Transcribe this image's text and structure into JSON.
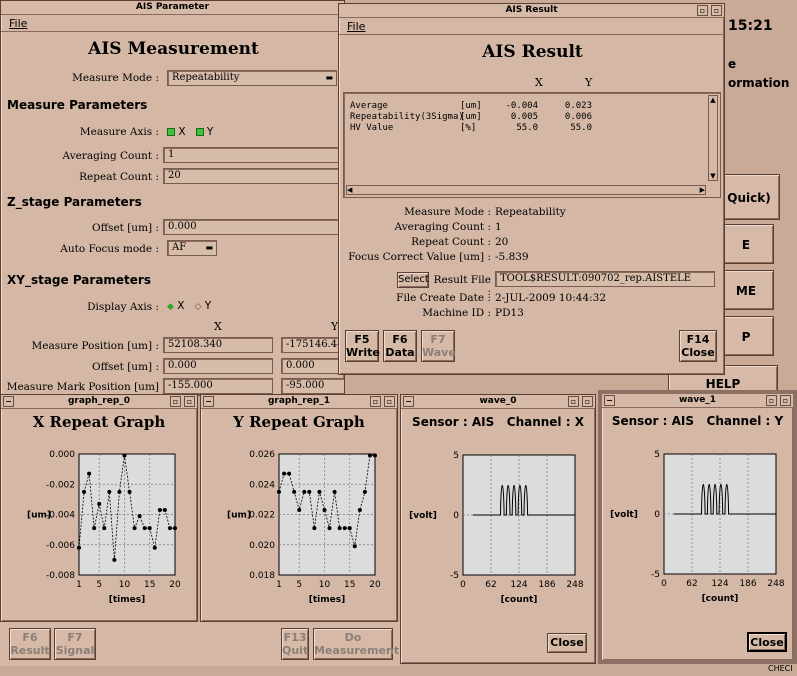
{
  "clock": "15:21",
  "right_panel": {
    "text_lines": [
      "e",
      "ormation"
    ],
    "buttons": [
      "Quick)",
      "E",
      "ME",
      "P",
      "HELP"
    ],
    "status": "CHECI"
  },
  "ais_parameter": {
    "title": "AIS Parameter",
    "menu_file": "File",
    "heading": "AIS Measurement",
    "measure_mode_label": "Measure Mode :",
    "measure_mode_value": "Repeatability",
    "sec_measure": "Measure Parameters",
    "measure_axis_label": "Measure Axis :",
    "axis_x": "X",
    "axis_y": "Y",
    "averaging_label": "Averaging Count :",
    "averaging_value": "1",
    "repeat_label": "Repeat Count :",
    "repeat_value": "20",
    "sec_z": "Z_stage Parameters",
    "offset_label": "Offset [um] :",
    "offset_value": "0.000",
    "af_label": "Auto Focus mode :",
    "af_value": "AF",
    "sec_xy": "XY_stage Parameters",
    "display_axis_label": "Display Axis :",
    "col_x": "X",
    "col_y": "Y",
    "meas_pos_label": "Measure Position [um] :",
    "meas_pos_x": "52108.340",
    "meas_pos_y": "-175146.440",
    "xy_offset_label": "Offset [um] :",
    "xy_offset_x": "0.000",
    "xy_offset_y": "0.000",
    "mark_pos_label": "Measure Mark Position [um] :",
    "mark_pos_x": "-155.000",
    "mark_pos_y": "-95.000",
    "btn_f6": [
      "F6",
      "Result"
    ],
    "btn_f7": [
      "F7",
      "Signal"
    ],
    "btn_f13": [
      "F13",
      "Quit"
    ],
    "btn_do": [
      "Do",
      "Measurement"
    ]
  },
  "ais_result": {
    "title": "AIS Result",
    "menu_file": "File",
    "heading": "AIS Result",
    "col_x": "X",
    "col_y": "Y",
    "rows": [
      {
        "name": "Average",
        "unit": "[um]",
        "x": "-0.004",
        "y": "0.023"
      },
      {
        "name": "Repeatability(3Sigma)",
        "unit": "[um]",
        "x": "0.005",
        "y": "0.006"
      },
      {
        "name": "HV Value",
        "unit": "[%]",
        "x": "55.0",
        "y": "55.0"
      }
    ],
    "measure_mode_label": "Measure Mode :",
    "measure_mode_value": "Repeatability",
    "averaging_label": "Averaging Count :",
    "averaging_value": "1",
    "repeat_label": "Repeat Count :",
    "repeat_value": "20",
    "focus_label": "Focus Correct Value [um] :",
    "focus_value": "-5.839",
    "select_btn": "Select",
    "result_file_label": "Result File :",
    "result_file_value": "TOOL$RESULT:090702_rep.AISTELE",
    "create_date_label": "File Create Date :",
    "create_date_value": "2-JUL-2009 10:44:32",
    "machine_label": "Machine ID :",
    "machine_value": "PD13",
    "btn_f5": [
      "F5",
      "Write"
    ],
    "btn_f6": [
      "F6",
      "Data"
    ],
    "btn_f7": [
      "F7",
      "Wave"
    ],
    "btn_f14": [
      "F14",
      "Close"
    ]
  },
  "graph_rep_0": {
    "title": "graph_rep_0",
    "heading": "X Repeat Graph"
  },
  "graph_rep_1": {
    "title": "graph_rep_1",
    "heading": "Y Repeat Graph"
  },
  "wave_0": {
    "title": "wave_0",
    "heading": "Sensor : AIS   Channel : X",
    "close": "Close"
  },
  "wave_1": {
    "title": "wave_1",
    "heading": "Sensor : AIS   Channel : Y",
    "close": "Close"
  },
  "chart_data": [
    {
      "type": "line",
      "id": "x_repeat",
      "title": "X Repeat Graph",
      "xlabel": "[times]",
      "ylabel": "[um]",
      "xlim": [
        1,
        20
      ],
      "ylim": [
        -0.008,
        0.0
      ],
      "xticks": [
        "1",
        "5",
        "10",
        "15",
        "20"
      ],
      "yticks": [
        "0.000",
        "-0.002",
        "-0.004",
        "-0.006",
        "-0.008"
      ],
      "x": [
        1,
        2,
        3,
        4,
        5,
        6,
        7,
        8,
        9,
        10,
        11,
        12,
        13,
        14,
        15,
        16,
        17,
        18,
        19,
        20
      ],
      "values": [
        -0.0062,
        -0.0025,
        -0.0013,
        -0.0049,
        -0.0033,
        -0.0049,
        -0.0025,
        -0.007,
        -0.0025,
        -0.0001,
        -0.0025,
        -0.0049,
        -0.0041,
        -0.0049,
        -0.0049,
        -0.0062,
        -0.0037,
        -0.0037,
        -0.0049,
        -0.0049
      ],
      "grid": true
    },
    {
      "type": "line",
      "id": "y_repeat",
      "title": "Y Repeat Graph",
      "xlabel": "[times]",
      "ylabel": "[um]",
      "xlim": [
        1,
        20
      ],
      "ylim": [
        0.018,
        0.026
      ],
      "xticks": [
        "1",
        "5",
        "10",
        "15",
        "20"
      ],
      "yticks": [
        "0.026",
        "0.024",
        "0.022",
        "0.020",
        "0.018"
      ],
      "x": [
        1,
        2,
        3,
        4,
        5,
        6,
        7,
        8,
        9,
        10,
        11,
        12,
        13,
        14,
        15,
        16,
        17,
        18,
        19,
        20
      ],
      "values": [
        0.0235,
        0.0247,
        0.0247,
        0.0235,
        0.0223,
        0.0235,
        0.0235,
        0.0211,
        0.0235,
        0.0223,
        0.0211,
        0.0235,
        0.0211,
        0.0211,
        0.0211,
        0.0199,
        0.0223,
        0.0235,
        0.0259,
        0.0259
      ],
      "grid": true
    },
    {
      "type": "line",
      "id": "wave_x",
      "title": "Sensor : AIS   Channel : X",
      "xlabel": "[count]",
      "ylabel": "[volt]",
      "xlim": [
        0,
        248
      ],
      "ylim": [
        -5,
        5
      ],
      "xticks": [
        "0",
        "62",
        "124",
        "186",
        "248"
      ],
      "yticks": [
        "5",
        "0",
        "-5"
      ],
      "baseline": 0,
      "peak": 3.3,
      "pulse_centers": [
        87,
        100,
        113,
        126,
        139
      ],
      "signal_range": [
        22,
        248
      ],
      "grid": true
    },
    {
      "type": "line",
      "id": "wave_y",
      "title": "Sensor : AIS   Channel : Y",
      "xlabel": "[count]",
      "ylabel": "[volt]",
      "xlim": [
        0,
        248
      ],
      "ylim": [
        -5,
        5
      ],
      "xticks": [
        "0",
        "62",
        "124",
        "186",
        "248"
      ],
      "yticks": [
        "5",
        "0",
        "-5"
      ],
      "baseline": 0,
      "peak": 3.3,
      "pulse_centers": [
        87,
        100,
        113,
        126,
        139
      ],
      "signal_range": [
        22,
        248
      ],
      "grid": true
    }
  ]
}
